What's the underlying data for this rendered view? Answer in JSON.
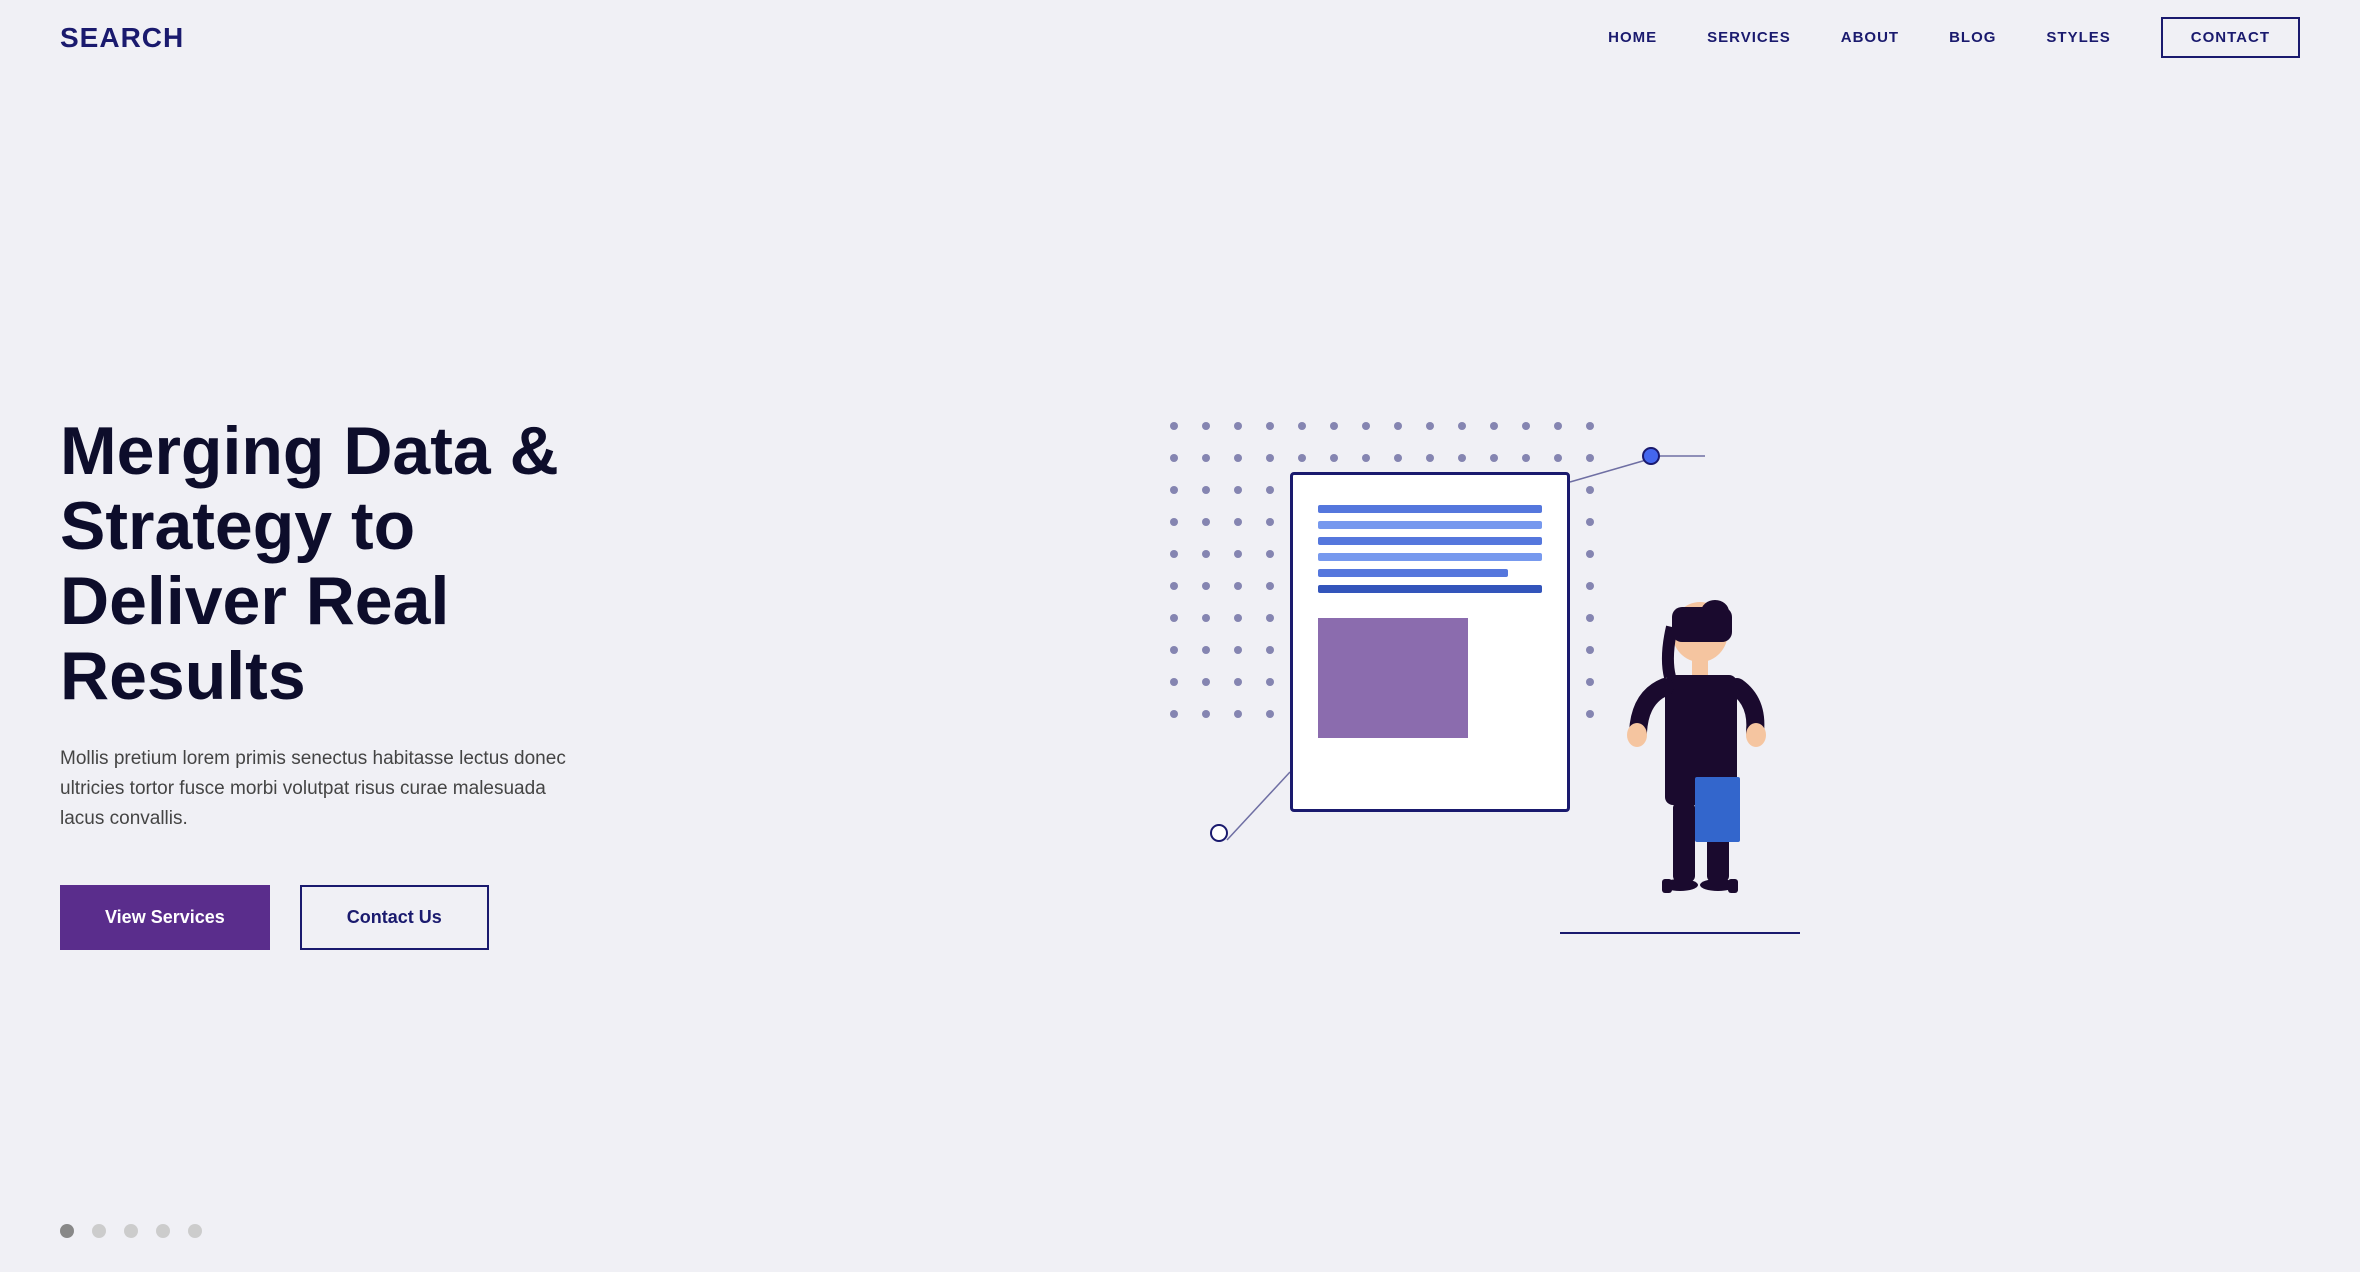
{
  "nav": {
    "logo": "SEARCH",
    "links": [
      {
        "label": "HOME",
        "id": "home"
      },
      {
        "label": "SERVICES",
        "id": "services"
      },
      {
        "label": "ABOUT",
        "id": "about"
      },
      {
        "label": "BLOG",
        "id": "blog"
      },
      {
        "label": "STYLES",
        "id": "styles"
      },
      {
        "label": "CONTACT",
        "id": "contact",
        "isButton": true
      }
    ]
  },
  "hero": {
    "title": "Merging Data & Strategy to Deliver Real Results",
    "subtitle": "Mollis pretium lorem primis senectus habitasse lectus donec ultricies tortor fusce morbi volutpat risus curae malesuada lacus convallis.",
    "btn_primary": "View Services",
    "btn_secondary": "Contact Us"
  },
  "pagination": {
    "dots": 5,
    "active": 0
  }
}
